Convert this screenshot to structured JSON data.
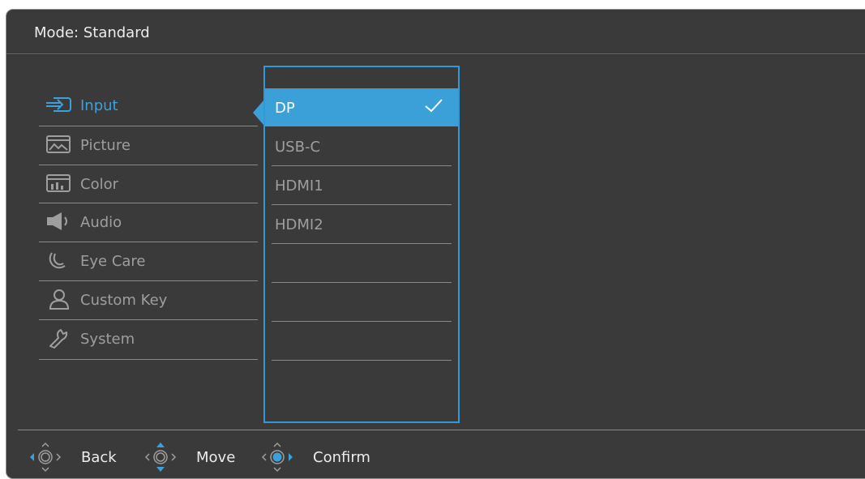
{
  "header": {
    "title": "Mode: Standard"
  },
  "menu": {
    "items": [
      {
        "label": "Input",
        "icon": "input-icon",
        "active": true
      },
      {
        "label": "Picture",
        "icon": "picture-icon"
      },
      {
        "label": "Color",
        "icon": "color-icon"
      },
      {
        "label": "Audio",
        "icon": "audio-icon"
      },
      {
        "label": "Eye Care",
        "icon": "eye-care-icon"
      },
      {
        "label": "Custom Key",
        "icon": "custom-key-icon"
      },
      {
        "label": "System",
        "icon": "system-icon"
      }
    ]
  },
  "submenu": {
    "items": [
      {
        "label": "DP",
        "selected": true
      },
      {
        "label": "USB-C"
      },
      {
        "label": "HDMI1"
      },
      {
        "label": "HDMI2"
      }
    ]
  },
  "footer": {
    "back": "Back",
    "move": "Move",
    "confirm": "Confirm"
  },
  "colors": {
    "accent": "#3b9fd8",
    "background": "#3a3a3a",
    "inactive_text": "#9e9e9e",
    "text": "#ececec"
  }
}
